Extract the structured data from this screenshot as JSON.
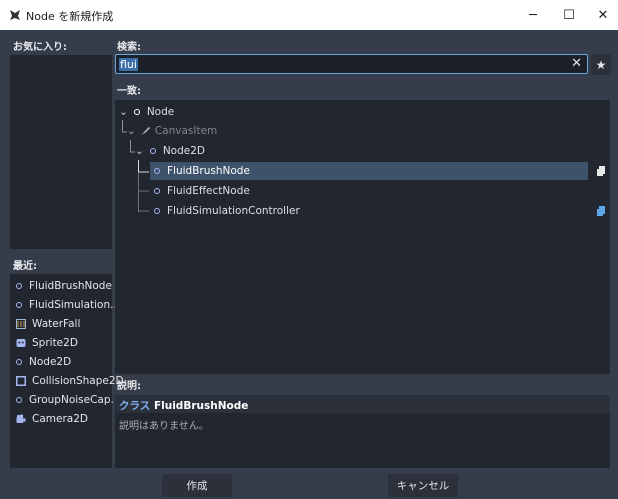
{
  "window": {
    "title": "Node を新規作成",
    "minimize_icon": "─",
    "maximize_icon": "☐",
    "close_icon": "✕"
  },
  "favorites": {
    "label": "お気に入り:"
  },
  "search": {
    "label": "検索:",
    "value": "fluid",
    "display": "flui",
    "clear_icon": "✕",
    "favorite_icon": "★"
  },
  "matches": {
    "label": "一致:",
    "tree": [
      {
        "label": "Node",
        "arrow": "⌄",
        "state": "normal"
      },
      {
        "label": "CanvasItem",
        "arrow": "⌄",
        "state": "disabled"
      },
      {
        "label": "Node2D",
        "arrow": "⌄",
        "state": "normal"
      },
      {
        "label": "FluidBrushNode",
        "state": "selected",
        "script": true
      },
      {
        "label": "FluidEffectNode",
        "state": "normal"
      },
      {
        "label": "FluidSimulationController",
        "state": "normal",
        "script": true,
        "script_color": "#5fa6e8"
      }
    ]
  },
  "recent": {
    "label": "最近:",
    "items": [
      {
        "label": "FluidBrushNode",
        "icon": "node-circle-icon"
      },
      {
        "label": "FluidSimulation...",
        "icon": "node-circle-icon"
      },
      {
        "label": "WaterFall",
        "icon": "waterfall-icon"
      },
      {
        "label": "Sprite2D",
        "icon": "sprite-icon"
      },
      {
        "label": "Node2D",
        "icon": "node-circle-icon"
      },
      {
        "label": "CollisionShape2D",
        "icon": "collision-shape-icon"
      },
      {
        "label": "GroupNoiseCap...",
        "icon": "node-circle-icon"
      },
      {
        "label": "Camera2D",
        "icon": "camera-icon"
      }
    ]
  },
  "description": {
    "label": "説明:",
    "class_keyword": "クラス",
    "class_name": "FluidBrushNode",
    "text": "説明はありません。"
  },
  "buttons": {
    "create": "作成",
    "cancel": "キャンセル"
  },
  "colors": {
    "accent": "#5fa6e8",
    "node_icon": "#a5b7f3",
    "selection": "#3e536b",
    "panel": "#22262f",
    "background": "#363d4a"
  }
}
